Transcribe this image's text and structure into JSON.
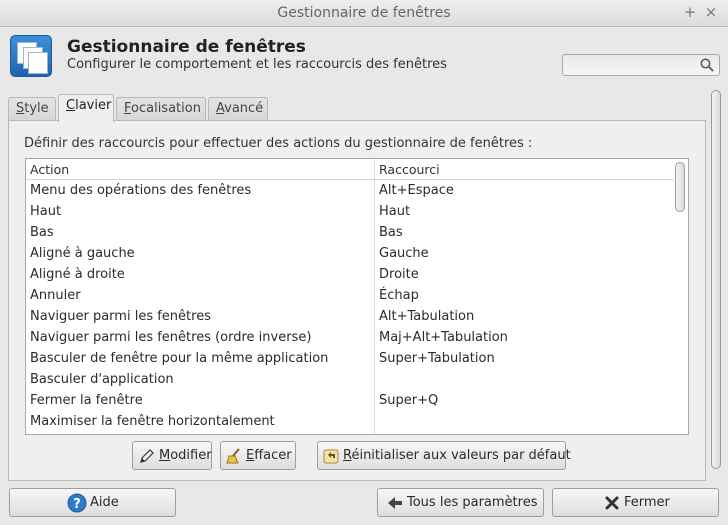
{
  "window": {
    "title": "Gestionnaire de fenêtres",
    "maximize_glyph": "+",
    "close_glyph": "×"
  },
  "header": {
    "title": "Gestionnaire de fenêtres",
    "subtitle": "Configurer le comportement et les raccourcis des fenêtres",
    "search_placeholder": ""
  },
  "tabs": [
    {
      "pre": "",
      "key": "S",
      "post": "tyle",
      "active": false
    },
    {
      "pre": "",
      "key": "C",
      "post": "lavier",
      "active": true
    },
    {
      "pre": "",
      "key": "F",
      "post": "ocalisation",
      "active": false
    },
    {
      "pre": "",
      "key": "A",
      "post": "vancé",
      "active": false
    }
  ],
  "panel": {
    "label": "Définir des raccourcis pour effectuer des actions du gestionnaire de fenêtres :",
    "columns": [
      "Action",
      "Raccourci"
    ],
    "rows": [
      [
        "Menu des opérations des fenêtres",
        "Alt+Espace"
      ],
      [
        "Haut",
        "Haut"
      ],
      [
        "Bas",
        "Bas"
      ],
      [
        "Aligné à gauche",
        "Gauche"
      ],
      [
        "Aligné à droite",
        "Droite"
      ],
      [
        "Annuler",
        "Échap"
      ],
      [
        "Naviguer parmi les fenêtres",
        "Alt+Tabulation"
      ],
      [
        "Naviguer parmi les fenêtres (ordre inverse)",
        "Maj+Alt+Tabulation"
      ],
      [
        "Basculer de fenêtre pour la même application",
        "Super+Tabulation"
      ],
      [
        "Basculer d'application",
        ""
      ],
      [
        "Fermer la fenêtre",
        "Super+Q"
      ],
      [
        "Maximiser la fenêtre horizontalement",
        ""
      ]
    ]
  },
  "actions": {
    "modify": {
      "key": "M",
      "rest": "odifier"
    },
    "clear": {
      "key": "E",
      "rest": "ffacer"
    },
    "reset": {
      "key": "R",
      "rest": "éinitialiser aux valeurs par défaut"
    }
  },
  "footer": {
    "help": "Aide",
    "all_settings": "Tous les paramètres",
    "close": "Fermer"
  },
  "colors": {
    "accent": "#2f7bcb",
    "window_bg": "#e8e8e8"
  }
}
